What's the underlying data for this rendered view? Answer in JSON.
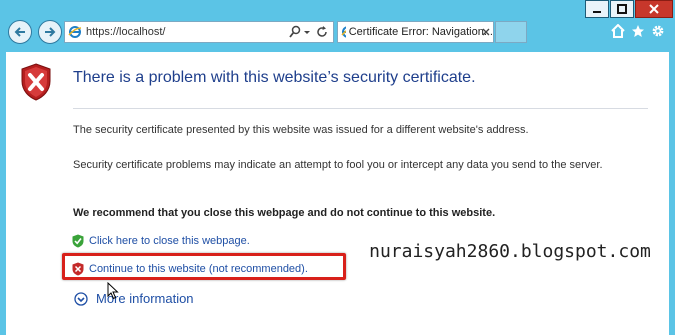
{
  "browser": {
    "url": "https://localhost/",
    "tab_title": "Certificate Error: Navigation...",
    "accent": "#5bc4e6",
    "icons": [
      "back-arrow-icon",
      "forward-arrow-icon",
      "ie-icon",
      "search-icon",
      "dropdown-icon",
      "refresh-icon",
      "close-icon",
      "home-icon",
      "star-icon",
      "gear-icon",
      "minimize-icon",
      "maximize-icon"
    ]
  },
  "page": {
    "heading": "There is a problem with this website’s security certificate.",
    "p1": "The security certificate presented by this website was issued for a different website's address.",
    "p2": "Security certificate problems may indicate an attempt to fool you or intercept any data you send to the server.",
    "p3": "We recommend that you close this webpage and do not continue to this website.",
    "close_link": "Click here to close this webpage.",
    "continue_link": "Continue to this website (not recommended).",
    "more_info": "More information",
    "heading_color": "#1f3f8c",
    "link_color": "#1f4fa5",
    "highlight_color": "#d8201a"
  },
  "watermark": "nuraisyah2860.blogspot.com"
}
